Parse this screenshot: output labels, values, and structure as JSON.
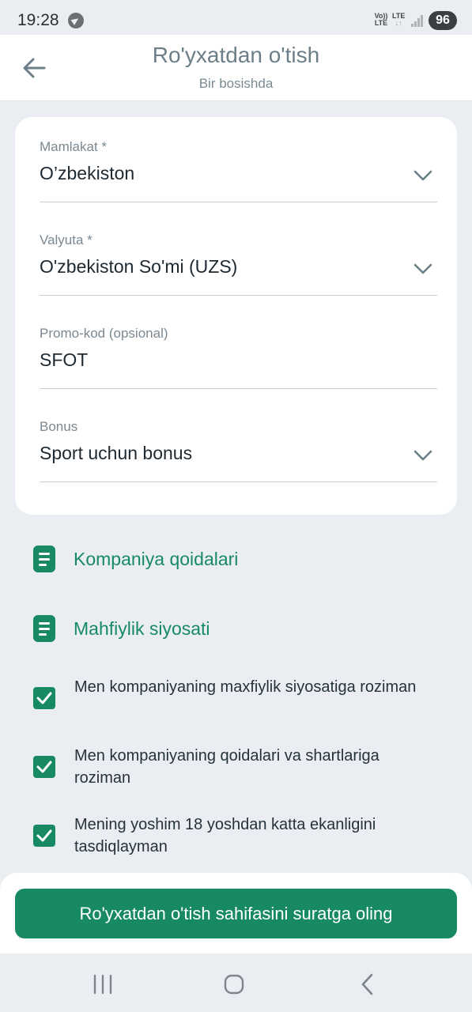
{
  "status": {
    "time": "19:28",
    "net1": "Vo)) LTE",
    "net2": "LTE",
    "battery": "96"
  },
  "header": {
    "title": "Ro'yxatdan o'tish",
    "subtitle": "Bir bosishda"
  },
  "form": {
    "country": {
      "label": "Mamlakat *",
      "value": "O’zbekiston"
    },
    "currency": {
      "label": "Valyuta *",
      "value": "O'zbekiston So'mi (UZS)"
    },
    "promo": {
      "label": "Promo-kod (opsional)",
      "value": "SFOT"
    },
    "bonus": {
      "label": "Bonus",
      "value": "Sport uchun bonus"
    }
  },
  "links": {
    "rules": "Kompaniya qoidalari",
    "privacy": "Mahfiylik siyosati"
  },
  "agreements": [
    {
      "text": "Men kompaniyaning maxfiylik siyosatiga roziman",
      "checked": true
    },
    {
      "text": "Men kompaniyaning qoidalari va shartlariga roziman",
      "checked": true
    },
    {
      "text": "Mening yoshim 18 yoshdan katta ekanligini tasdiqlayman",
      "checked": true
    }
  ],
  "actions": {
    "screenshot_button": "Ro'yxatdan o'tish sahifasini suratga oling"
  },
  "colors": {
    "accent": "#178a63",
    "background": "#eaeef2"
  }
}
